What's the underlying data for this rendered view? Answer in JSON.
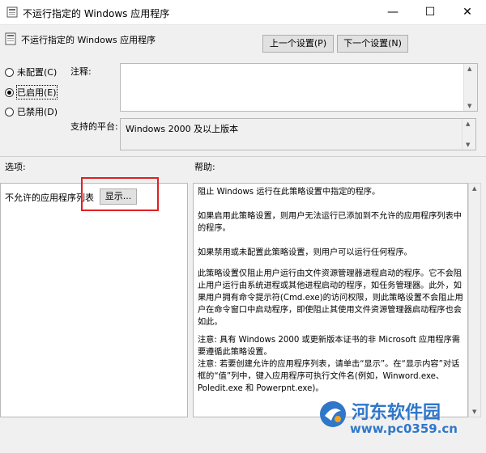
{
  "window": {
    "title": "不运行指定的 Windows 应用程序",
    "minimize_glyph": "—",
    "maximize_glyph": "☐",
    "close_glyph": "✕"
  },
  "header": {
    "policy_title": "不运行指定的 Windows 应用程序",
    "prev_button": "上一个设置(P)",
    "next_button": "下一个设置(N)"
  },
  "state": {
    "options": [
      {
        "label": "未配置(C)",
        "checked": false
      },
      {
        "label": "已启用(E)",
        "checked": true
      },
      {
        "label": "已禁用(D)",
        "checked": false
      }
    ]
  },
  "comment": {
    "label": "注释:",
    "value": ""
  },
  "platform": {
    "label": "支持的平台:",
    "value": "Windows 2000 及以上版本"
  },
  "sections": {
    "options_label": "选项:",
    "help_label": "帮助:"
  },
  "options_pane": {
    "list_label": "不允许的应用程序列表",
    "show_button": "显示..."
  },
  "help": {
    "paragraphs": [
      "阻止 Windows 运行在此策略设置中指定的程序。",
      "如果启用此策略设置，则用户无法运行已添加到不允许的应用程序列表中的程序。",
      "如果禁用或未配置此策略设置，则用户可以运行任何程序。",
      "此策略设置仅阻止用户运行由文件资源管理器进程启动的程序。它不会阻止用户运行由系统进程或其他进程启动的程序，如任务管理器。此外，如果用户拥有命令提示符(Cmd.exe)的访问权限，则此策略设置不会阻止用户在命令窗口中启动程序，即使阻止其使用文件资源管理器启动程序也会如此。",
      "注意: 具有 Windows 2000 或更新版本证书的非 Microsoft 应用程序需要遵循此策略设置。\n注意: 若要创建允许的应用程序列表，请单击“显示”。在“显示内容”对话框的“值”列中，键入应用程序可执行文件名(例如，Winword.exe、Poledit.exe 和 Powerpnt.exe)。"
    ]
  },
  "watermark": {
    "name": "河东软件园",
    "url": "www.pc0359.cn"
  },
  "colors": {
    "highlight_box": "#e02020",
    "watermark": "#2f77c9"
  }
}
